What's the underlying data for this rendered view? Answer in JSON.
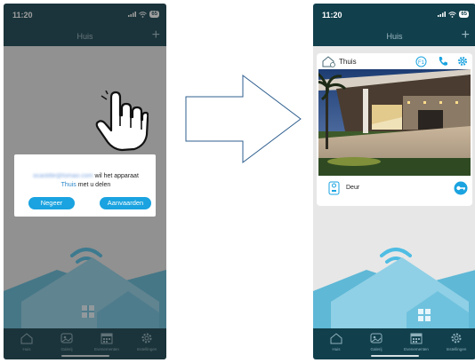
{
  "colors": {
    "navy": "#113f4c",
    "accent": "#1aa3e0",
    "tab_inactive": "#8fb0bb",
    "wifi": "#4fbde3"
  },
  "left_screen": {
    "status": {
      "time": "11:20",
      "battery": "65"
    },
    "nav_title": "Huis",
    "dialog": {
      "email": "ocastitle@tomao.com",
      "message_after_email": "wil het apparaat",
      "site_name": "Thuis",
      "message_end": "met u delen",
      "ignore_label": "Negeer",
      "accept_label": "Aanvaarden"
    },
    "icons": [
      "add-icon",
      "hand-pointer-icon",
      "wifi-icon"
    ]
  },
  "right_screen": {
    "status": {
      "time": "11:20",
      "battery": "65"
    },
    "nav_title": "Huis",
    "card": {
      "title": "Thuis",
      "badge": "F1",
      "icons": [
        "house-share-icon",
        "phone-icon",
        "gear-icon"
      ],
      "device_label": "Deur",
      "device_icons": [
        "intercom-icon",
        "key-icon"
      ]
    }
  },
  "tabs": [
    {
      "label": "Huis",
      "icon": "home-icon"
    },
    {
      "label": "Galerij",
      "icon": "gallery-icon"
    },
    {
      "label": "Evenementen",
      "icon": "calendar-icon"
    },
    {
      "label": "Instellingen",
      "icon": "gear-icon"
    }
  ]
}
